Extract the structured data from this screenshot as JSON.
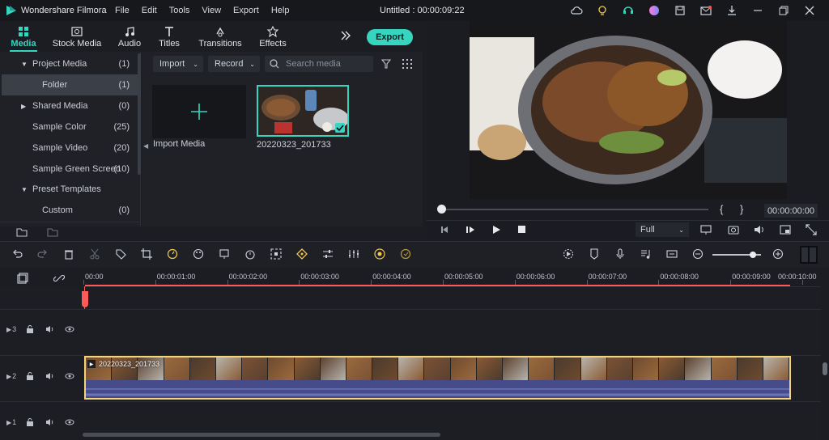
{
  "app": {
    "name": "Wondershare Filmora",
    "title": "Untitled : 00:00:09:22",
    "accent": "#36d5c0"
  },
  "menu": [
    "File",
    "Edit",
    "Tools",
    "View",
    "Export",
    "Help"
  ],
  "tabs": [
    {
      "label": "Media",
      "icon": "media-icon",
      "active": true
    },
    {
      "label": "Stock Media",
      "icon": "stock-media-icon"
    },
    {
      "label": "Audio",
      "icon": "audio-icon"
    },
    {
      "label": "Titles",
      "icon": "titles-icon"
    },
    {
      "label": "Transitions",
      "icon": "transitions-icon"
    },
    {
      "label": "Effects",
      "icon": "effects-icon"
    }
  ],
  "export_label": "Export",
  "sidebar": {
    "items": [
      {
        "label": "Project Media",
        "count": "(1)",
        "expanded": true
      },
      {
        "label": "Folder",
        "count": "(1)",
        "selected": true
      },
      {
        "label": "Shared Media",
        "count": "(0)",
        "expandable": true
      },
      {
        "label": "Sample Color",
        "count": "(25)"
      },
      {
        "label": "Sample Video",
        "count": "(20)"
      },
      {
        "label": "Sample Green Screen",
        "count": "(10)"
      },
      {
        "label": "Preset Templates",
        "count": "",
        "expanded": true
      },
      {
        "label": "Custom",
        "count": "(0)"
      }
    ]
  },
  "media": {
    "import_label": "Import",
    "record_label": "Record",
    "search_placeholder": "Search media",
    "import_tile_label": "Import Media",
    "clip_name": "20220323_201733"
  },
  "preview": {
    "timecode": "00:00:00:00",
    "quality": "Full",
    "bracket_in": "{",
    "bracket_out": "}"
  },
  "ruler": {
    "ticks": [
      "00:00",
      "00:00:01:00",
      "00:00:02:00",
      "00:00:03:00",
      "00:00:04:00",
      "00:00:05:00",
      "00:00:06:00",
      "00:00:07:00",
      "00:00:08:00",
      "00:00:09:00",
      "00:00:10:00"
    ]
  },
  "tracks": [
    {
      "num": "3"
    },
    {
      "num": "2",
      "clip": "20220323_201733"
    },
    {
      "num": "1"
    }
  ]
}
